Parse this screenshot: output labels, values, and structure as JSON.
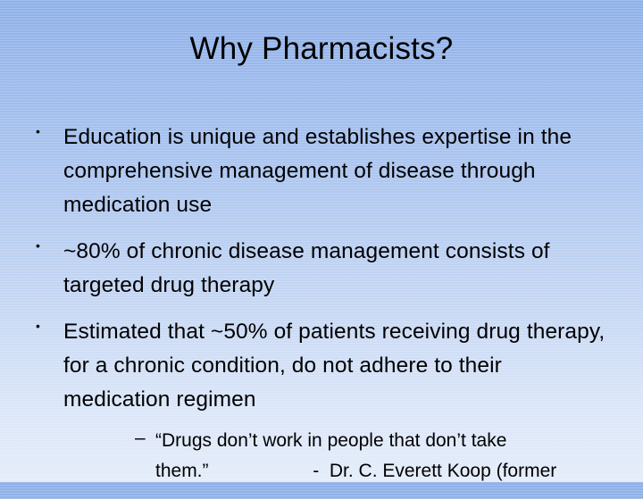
{
  "slide": {
    "title": "Why Pharmacists?",
    "bullets": [
      {
        "marker": "•",
        "text": "Education is unique and establishes expertise in the comprehensive management of disease through medication use"
      },
      {
        "marker": "•",
        "text": "~80% of chronic disease management consists of targeted drug therapy"
      },
      {
        "marker": "•",
        "text": "Estimated that ~50% of patients receiving drug therapy, for a chronic condition, do not adhere to their medication regimen"
      }
    ],
    "sub_bullet": {
      "marker": "–",
      "line1": "“Drugs don’t work in people that don’t take",
      "line2": "them.”                    -  Dr. C. Everett Koop (former"
    }
  },
  "colors": {
    "background_top": "#8fb0e8",
    "background_bottom": "#e4ecfa",
    "text": "#000000"
  }
}
